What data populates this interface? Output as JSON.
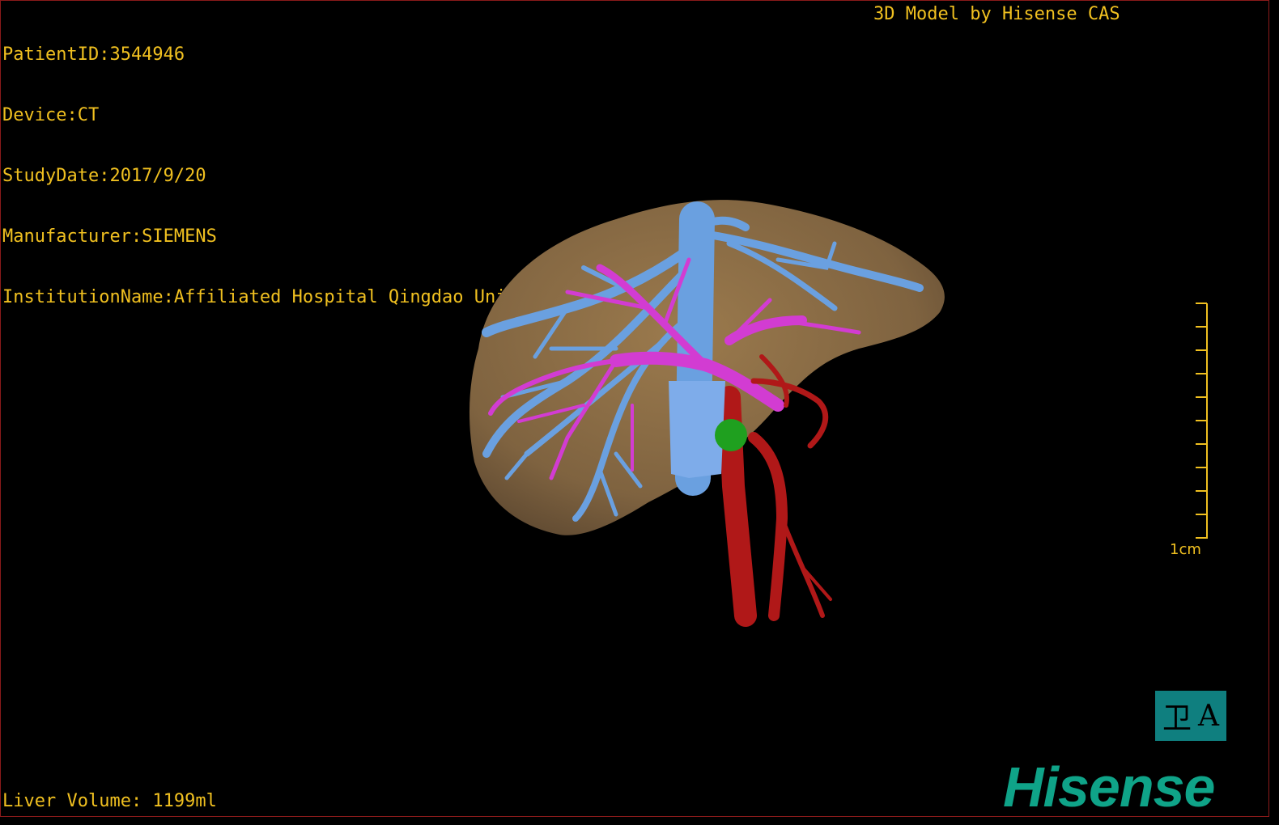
{
  "info": {
    "patient_id": "PatientID:3544946",
    "device": "Device:CT",
    "study_date": "StudyDate:2017/9/20",
    "manufacturer": "Manufacturer:SIEMENS",
    "institution": "InstitutionName:Affiliated Hospital Qingdao University-C"
  },
  "header_right": "3D Model by Hisense CAS",
  "liver_volume": "Liver Volume: 1199ml",
  "scale_label": "1cm",
  "orientation": {
    "left_glyph": "卫",
    "right_glyph": "A"
  },
  "brand": "Hisense",
  "colors": {
    "overlay_text": "#f0c020",
    "liver": "#8b6b43",
    "hepatic_vein": "#6aa0e0",
    "portal_vein": "#d23cd2",
    "artery": "#b01818",
    "gland": "#1fa01f",
    "brand": "#0fa388"
  }
}
